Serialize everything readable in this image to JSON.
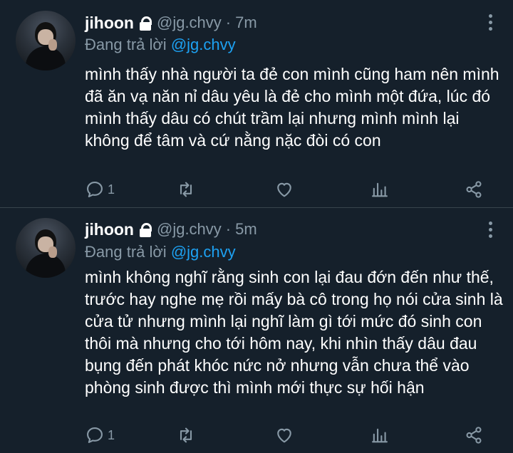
{
  "tweets": [
    {
      "name": "jihoon",
      "handle": "@jg.chvy",
      "separator": "·",
      "time": "7m",
      "reply_prefix": "Đang trả lời",
      "reply_to": "@jg.chvy",
      "text": "mình thấy nhà người ta đẻ con mình cũng ham nên mình đã ăn vạ năn nỉ dâu yêu là đẻ cho mình một đứa, lúc đó mình thấy dâu có chút trầm lại nhưng mình mình lại không để tâm và cứ nằng nặc đòi có con",
      "reply_count": "1"
    },
    {
      "name": "jihoon",
      "handle": "@jg.chvy",
      "separator": "·",
      "time": "5m",
      "reply_prefix": "Đang trả lời",
      "reply_to": "@jg.chvy",
      "text": "mình không nghĩ rằng sinh con lại đau đớn đến như thế, trước hay nghe mẹ rồi mấy bà cô trong họ nói cửa sinh là cửa tử nhưng mình lại nghĩ làm gì tới mức đó sinh con thôi mà nhưng cho tới hôm nay, khi nhìn thấy dâu đau bụng đến phát khóc nức nở nhưng vẫn chưa thể vào phòng sinh được thì mình mới thực sự hối hận",
      "reply_count": "1"
    }
  ],
  "icons": {
    "verified_lock": "lock-icon",
    "more": "more-icon",
    "reply": "reply-icon",
    "retweet": "retweet-icon",
    "like": "heart-icon",
    "stats": "stats-icon",
    "share": "share-icon"
  },
  "colors": {
    "background": "#15202b",
    "text": "#ffffff",
    "secondary": "#8899a6",
    "mention": "#1da1f2",
    "divider": "#38444d"
  }
}
